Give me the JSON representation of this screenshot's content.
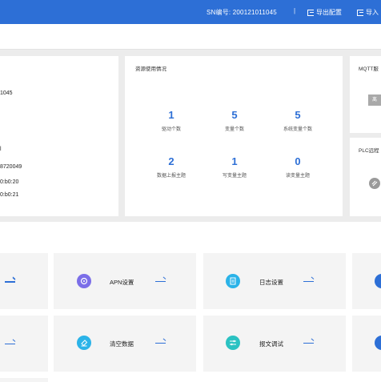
{
  "topbar": {
    "sn_text": "SN编号: 200121011045",
    "separator": "|",
    "export_label": "导出配置",
    "import_label": "导入"
  },
  "device_info": {
    "lines": [
      "1045",
      "l",
      "8720049",
      "0:b0:20",
      "0:b0:21"
    ]
  },
  "resource": {
    "title": "资源使用情况",
    "stats": [
      {
        "value": "1",
        "label": "驱动个数"
      },
      {
        "value": "5",
        "label": "变量个数"
      },
      {
        "value": "5",
        "label": "系统变量个数"
      },
      {
        "value": "2",
        "label": "数据上报主题"
      },
      {
        "value": "1",
        "label": "写变量主题"
      },
      {
        "value": "0",
        "label": "读变量主题"
      }
    ]
  },
  "mqtt": {
    "title": "MQTT服",
    "tag": "离"
  },
  "plc": {
    "title": "PLC远程"
  },
  "tiles": {
    "apn": {
      "label": "APN设置",
      "icon": "apn-icon",
      "color": "#7b6ee8"
    },
    "log": {
      "label": "日志设置",
      "icon": "log-icon",
      "color": "#2bb3e8"
    },
    "clear": {
      "label": "清空数据",
      "icon": "eraser-icon",
      "color": "#2bb3e8"
    },
    "debug": {
      "label": "报文调试",
      "icon": "sliders-icon",
      "color": "#2bc2c2"
    }
  },
  "colors": {
    "accent": "#2d6fd6",
    "topbar": "#2d6fd6"
  }
}
